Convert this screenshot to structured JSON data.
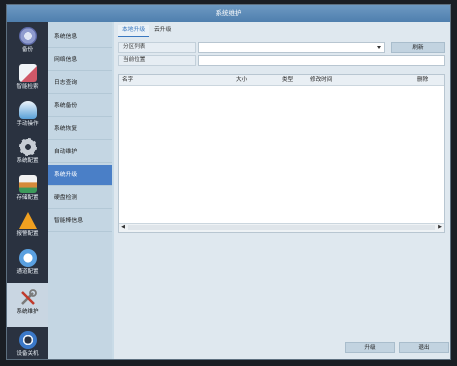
{
  "window": {
    "title": "系统维护"
  },
  "iconbar": {
    "items": [
      {
        "label": "备份",
        "icon": "backup-icon",
        "color": "#8f9ccf"
      },
      {
        "label": "智能检索",
        "icon": "search-icon",
        "color": "#d05868"
      },
      {
        "label": "手动操作",
        "icon": "hand-icon",
        "color": "#58a0d8"
      },
      {
        "label": "系统配置",
        "icon": "gear-icon",
        "color": "#c6ccd4"
      },
      {
        "label": "存储配置",
        "icon": "storage-icon",
        "color": "#d68a3a"
      },
      {
        "label": "报警配置",
        "icon": "alarm-icon",
        "color": "#f0a020"
      },
      {
        "label": "通道配置",
        "icon": "channel-icon",
        "color": "#5aa0e0"
      },
      {
        "label": "系统维护",
        "icon": "tools-icon",
        "color": "#8a8a8a"
      },
      {
        "label": "设备关机",
        "icon": "power-icon",
        "color": "#3a78c8"
      }
    ]
  },
  "subnav": {
    "items": [
      {
        "label": "系统信息"
      },
      {
        "label": "网络信息"
      },
      {
        "label": "日志查询"
      },
      {
        "label": "系统备份"
      },
      {
        "label": "系统恢复"
      },
      {
        "label": "自动维护"
      },
      {
        "label": "系统升级"
      },
      {
        "label": "硬盘检测"
      },
      {
        "label": "智能棒信息"
      }
    ]
  },
  "tabs": {
    "local": "本地升级",
    "cloud": "云升级"
  },
  "form": {
    "partition_label": "分区列表",
    "partition_value": "",
    "location_label": "当前位置",
    "location_value": "",
    "refresh": "刷新"
  },
  "table": {
    "columns": [
      "名字",
      "大小",
      "类型",
      "修改时间",
      "删除"
    ]
  },
  "footer": {
    "upgrade": "升级",
    "exit": "退出"
  }
}
